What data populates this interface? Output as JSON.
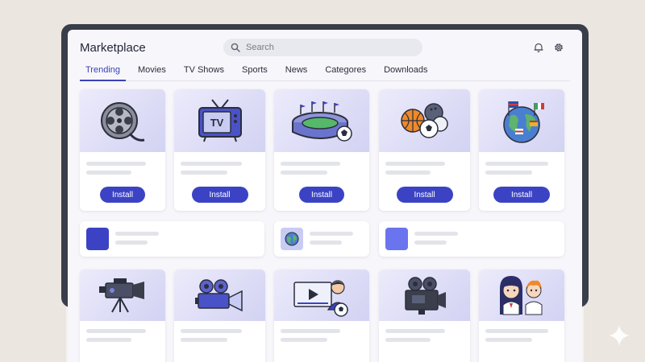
{
  "app": {
    "title": "Marketplace"
  },
  "search": {
    "placeholder": "Search"
  },
  "header_icons": [
    "bell-icon",
    "gear-icon"
  ],
  "tabs": [
    {
      "label": "Trending",
      "active": true
    },
    {
      "label": "Movies"
    },
    {
      "label": "TV Shows"
    },
    {
      "label": "Sports"
    },
    {
      "label": "News"
    },
    {
      "label": "Categores"
    },
    {
      "label": "Downloads"
    }
  ],
  "row1": [
    {
      "icon": "film-reel-icon",
      "install_label": "Install"
    },
    {
      "icon": "tv-icon",
      "icon_text": "TV",
      "install_label": "Install"
    },
    {
      "icon": "stadium-icon",
      "install_label": "Install"
    },
    {
      "icon": "sports-balls-icon",
      "install_label": "Install"
    },
    {
      "icon": "globe-flags-icon",
      "install_label": "Install"
    }
  ],
  "row2": [
    {
      "icon": "blue-square-icon",
      "color": "#3b43c4"
    },
    {
      "icon": "globe-thumb-icon"
    },
    {
      "icon": "blue-square-icon",
      "color": "#6a74ee"
    }
  ],
  "row3": [
    {
      "icon": "video-camera-tripod-icon"
    },
    {
      "icon": "movie-camera-icon"
    },
    {
      "icon": "video-player-presenter-icon"
    },
    {
      "icon": "film-camera-icon"
    },
    {
      "icon": "anime-characters-icon"
    }
  ],
  "colors": {
    "accent": "#3b43c4",
    "background": "#ebe6e0",
    "frame": "#3a3d4a"
  }
}
